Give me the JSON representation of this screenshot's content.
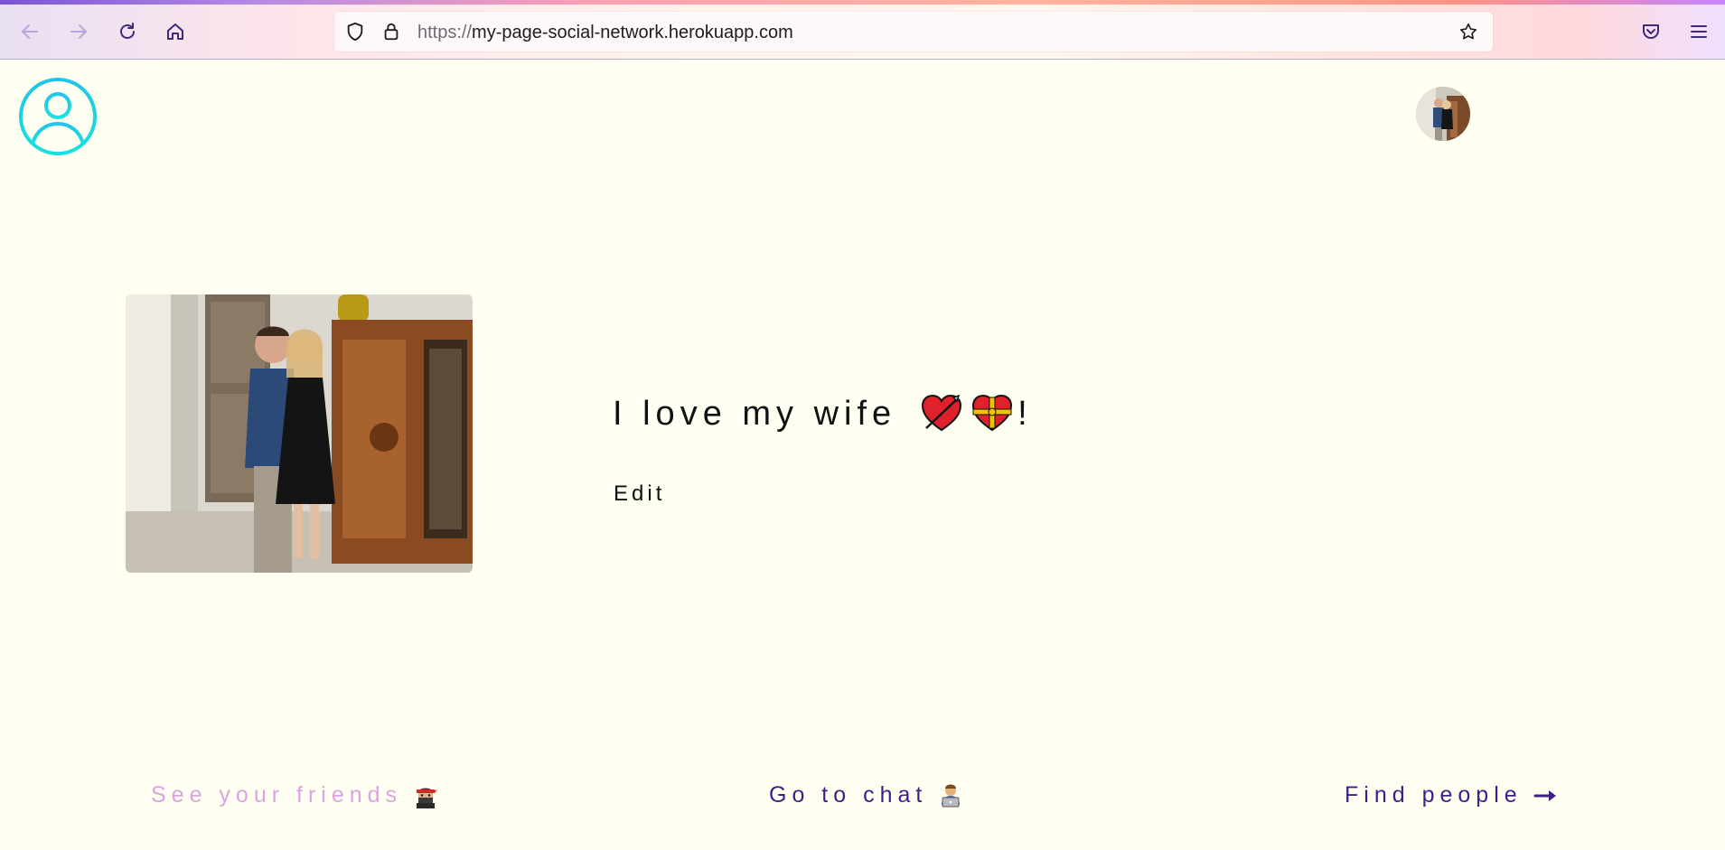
{
  "browser": {
    "url_protocol": "https://",
    "url_host": "my-page-social-network.herokuapp.com",
    "icons": [
      "back-arrow-icon",
      "forward-arrow-icon",
      "reload-icon",
      "home-icon",
      "shield-icon",
      "lock-icon",
      "star-icon",
      "pocket-icon",
      "hamburger-menu-icon"
    ]
  },
  "header": {
    "logo_icon": "user-circle-icon",
    "accent_color": "#1bd3e6"
  },
  "profile": {
    "bio_prefix": "I love my wife",
    "bio_suffix": "!",
    "bio_emojis": [
      "heart-with-arrow-icon",
      "heart-with-ribbon-icon"
    ],
    "edit_label": "Edit"
  },
  "nav": {
    "friends_label": "See your friends",
    "friends_emoji": "ninja-icon",
    "chat_label": "Go to chat",
    "chat_emoji": "person-on-laptop-icon",
    "find_label": "Find people",
    "find_emoji": "right-arrow-icon"
  }
}
